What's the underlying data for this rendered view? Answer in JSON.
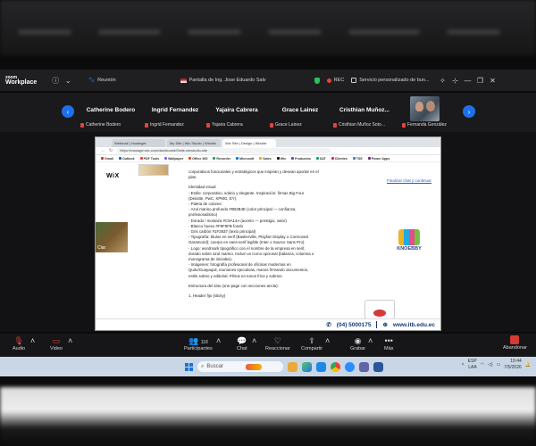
{
  "zoom": {
    "logo_line1": "zoom",
    "logo_line2": "Workplace",
    "meeting_label": "Reunión",
    "share_title": "Pantalla de Ing. Jose Eduardo Salv",
    "rec_label": "REC",
    "service_label": "Servicio personalizado de bun...",
    "icons": {
      "info": "info-icon",
      "paw": "paw-icon",
      "shield": "shield-icon",
      "rec": "record-icon"
    }
  },
  "gallery": {
    "participants": [
      {
        "name": "Catherine Bodero",
        "label": "Catherine Bodero"
      },
      {
        "name": "Ingrid Fernandez",
        "label": "Ingrid Fernandez"
      },
      {
        "name": "Yajaira Cabrera",
        "label": "Yajaira Cabrera"
      },
      {
        "name": "Grace Lainez",
        "label": "Grace Lainez"
      },
      {
        "name": "Cristhian  Muñoz...",
        "label": "Cristhian Muñoz Soto..."
      }
    ],
    "video_participant": {
      "label": "Fernanda González"
    }
  },
  "browser": {
    "tabs": [
      "Webmail | Hostinger",
      "My Site | Wix Studio | Wixsite",
      "Wix Site | Design | Wixsite"
    ],
    "url": "https://manage.wix.com/dashboard/0/site-wixstudio-site",
    "bookmarks": [
      "Gmail",
      "Outlook",
      "PDF Tools",
      "Wallpaper",
      "Office 365",
      "Recorder",
      "Microsoft",
      "Sales",
      "Wix",
      "Productos",
      "SAT",
      "Clientes",
      "TSE",
      "Power Apps"
    ],
    "wix_logo": "WiX",
    "share_link": "Finalizar chat y continuar",
    "knoebby": "KNOEBBY",
    "left_thumb_label": "Clar",
    "doc_lines": [
      "corporativos funcionales y estratégicos que inspiran y desean aportar en el",
      "plan.",
      "",
      "Identidad visual",
      "- Estilo: corporativo, sobrio y elegante. Inspiración: firmas Big Four",
      "(Deloitte, PwC, KPMG, EY).",
      "- Paleta de colores:",
      "  · Azul marino profundo #0B2B4E (color principal — confianza,",
      "  profesionalismo)",
      "  · Dorado / mostaza #C9A14A (acento — prestigio, valor)",
      "  · Blanco hueso #F8F9FB fondo",
      "  · Gris carbón #1F2937 (texto principal)",
      "- Tipografía: títulos en serif (Baskerville, Playfair Display o Cormorant",
      "Garamond); cuerpo en sans-serif legible (Inter o Source Sans Pro).",
      "- Logo: wordmark tipográfico con el nombre de la empresa en serif,",
      "dorado sobre azul marino. Incluir un ícono opcional (balanza, columna o",
      "monograma de iniciales).",
      "- Imágenes: fotografía profesional de oficinas modernas en",
      "Quito/Guayaquil, reuniones ejecutivas, manos firmando documentos,",
      "estilo sobrio y editorial. Filtros en tonos fríos y sobrios.",
      "",
      "Estructura del sitio (one-page con secciones ancla):",
      "",
      "1. Header fijo (sticky)"
    ],
    "footer_phone": "(04) 5000175",
    "footer_url": "www.itb.edu.ec"
  },
  "controls": {
    "audio": "Audio",
    "video": "Video",
    "participants": "Participantes",
    "participants_count": "118",
    "chat": "Chat",
    "react": "Reaccionar",
    "share": "Compartir",
    "record": "Grabar",
    "more": "Más",
    "end": "Abandonar"
  },
  "taskbar": {
    "search_placeholder": "Buscar",
    "lang_line1": "ESP",
    "lang_line2": "LAA",
    "time": "19:44",
    "date": "7/5/2026"
  }
}
